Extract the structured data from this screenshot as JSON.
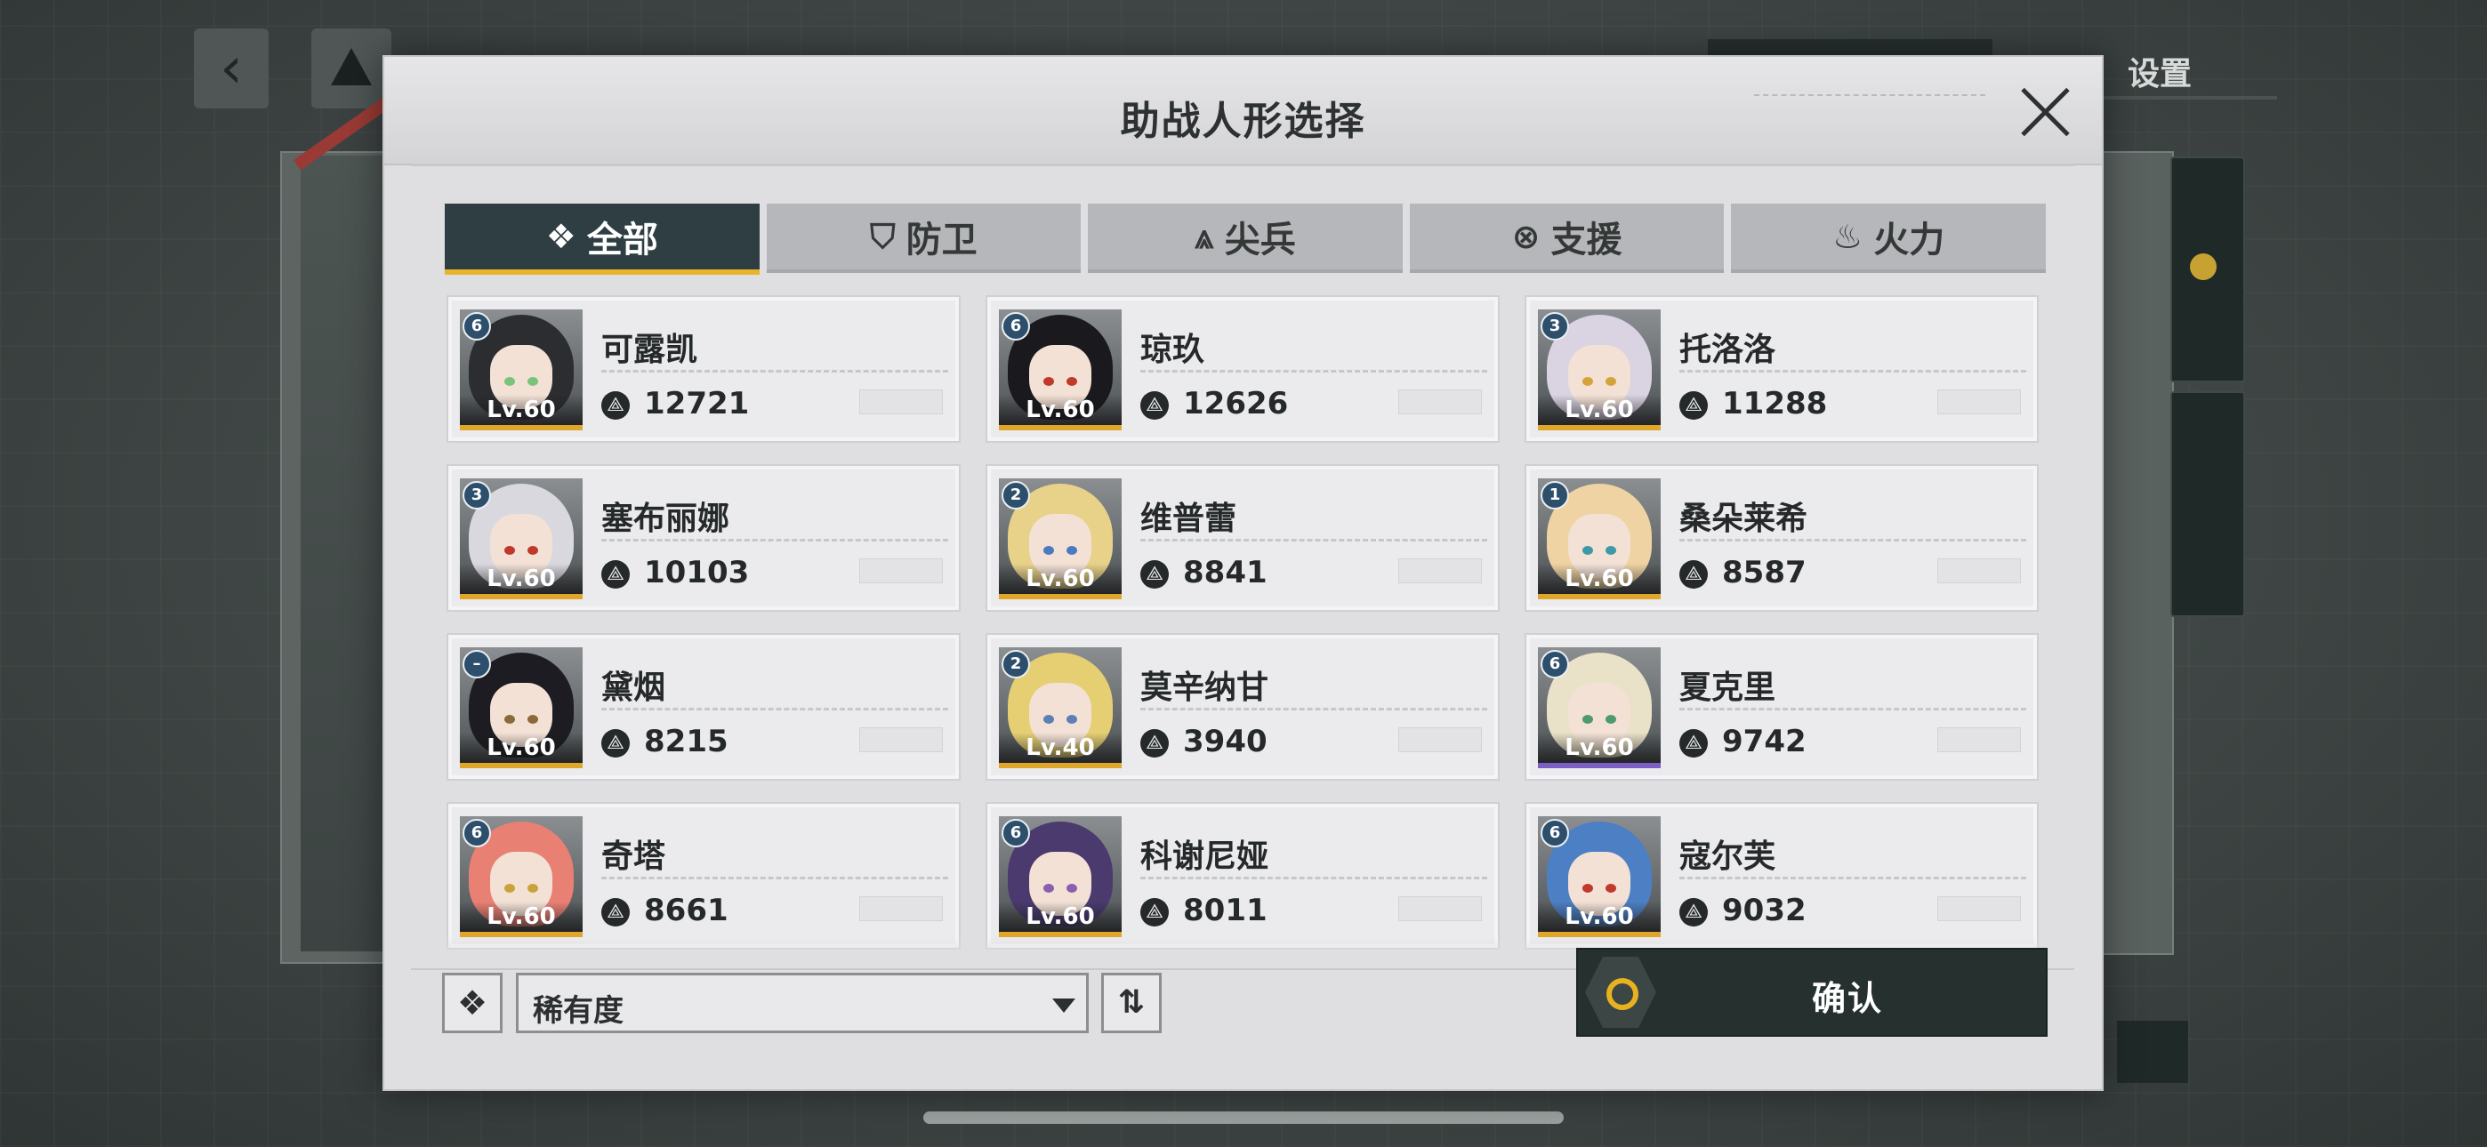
{
  "window": {
    "title": "助战人形选择",
    "background_settings_label": "设置"
  },
  "tabs": [
    {
      "label": "全部",
      "icon": "diamond-icon",
      "active": true
    },
    {
      "label": "防卫",
      "icon": "shield-icon",
      "active": false
    },
    {
      "label": "尖兵",
      "icon": "spearhead-icon",
      "active": false
    },
    {
      "label": "支援",
      "icon": "support-icon",
      "active": false
    },
    {
      "label": "火力",
      "icon": "flame-icon",
      "active": false
    }
  ],
  "dolls": [
    {
      "name": "可露凯",
      "power": "12721",
      "level": "Lv.60",
      "badge": "6",
      "rarity_color": "#e0a62a",
      "hair": "#2b2d30",
      "eye": "#7ac37a"
    },
    {
      "name": "琼玖",
      "power": "12626",
      "level": "Lv.60",
      "badge": "6",
      "rarity_color": "#e0a62a",
      "hair": "#1a1a1e",
      "eye": "#c0392b"
    },
    {
      "name": "托洛洛",
      "power": "11288",
      "level": "Lv.60",
      "badge": "3",
      "rarity_color": "#e0a62a",
      "hair": "#d9d3e2",
      "eye": "#d4a43a"
    },
    {
      "name": "塞布丽娜",
      "power": "10103",
      "level": "Lv.60",
      "badge": "3",
      "rarity_color": "#e0a62a",
      "hair": "#d8d8de",
      "eye": "#c0392b"
    },
    {
      "name": "维普蕾",
      "power": "8841",
      "level": "Lv.60",
      "badge": "2",
      "rarity_color": "#e0a62a",
      "hair": "#e8d28a",
      "eye": "#4a7bc0"
    },
    {
      "name": "桑朵莱希",
      "power": "8587",
      "level": "Lv.60",
      "badge": "1",
      "rarity_color": "#e0a62a",
      "hair": "#efd3a2",
      "eye": "#3d9aa5"
    },
    {
      "name": "黛烟",
      "power": "8215",
      "level": "Lv.60",
      "badge": "–",
      "rarity_color": "#e0a62a",
      "hair": "#1c1c22",
      "eye": "#8a6a3a"
    },
    {
      "name": "莫辛纳甘",
      "power": "3940",
      "level": "Lv.40",
      "badge": "2",
      "rarity_color": "#e0a62a",
      "hair": "#e6cf73",
      "eye": "#5c7fb5"
    },
    {
      "name": "夏克里",
      "power": "9742",
      "level": "Lv.60",
      "badge": "6",
      "rarity_color": "#7b5fc4",
      "hair": "#e9e1c8",
      "eye": "#4f9a6a"
    },
    {
      "name": "奇塔",
      "power": "8661",
      "level": "Lv.60",
      "badge": "6",
      "rarity_color": "#e0a62a",
      "hair": "#e98074",
      "eye": "#c9a23a"
    },
    {
      "name": "科谢尼娅",
      "power": "8011",
      "level": "Lv.60",
      "badge": "6",
      "rarity_color": "#e0a62a",
      "hair": "#4a3a6e",
      "eye": "#8a5fb0"
    },
    {
      "name": "寇尔芙",
      "power": "9032",
      "level": "Lv.60",
      "badge": "6",
      "rarity_color": "#e0a62a",
      "hair": "#4d7fc4",
      "eye": "#c0392b"
    }
  ],
  "footer": {
    "filter_icon": "diamond-filter-icon",
    "sort_label": "稀有度",
    "order_icon": "sort-order-icon",
    "confirm_label": "确认"
  },
  "colors": {
    "accent": "#e8b42a",
    "active_tab": "#2e3e42",
    "confirm_bg": "#26302f"
  }
}
